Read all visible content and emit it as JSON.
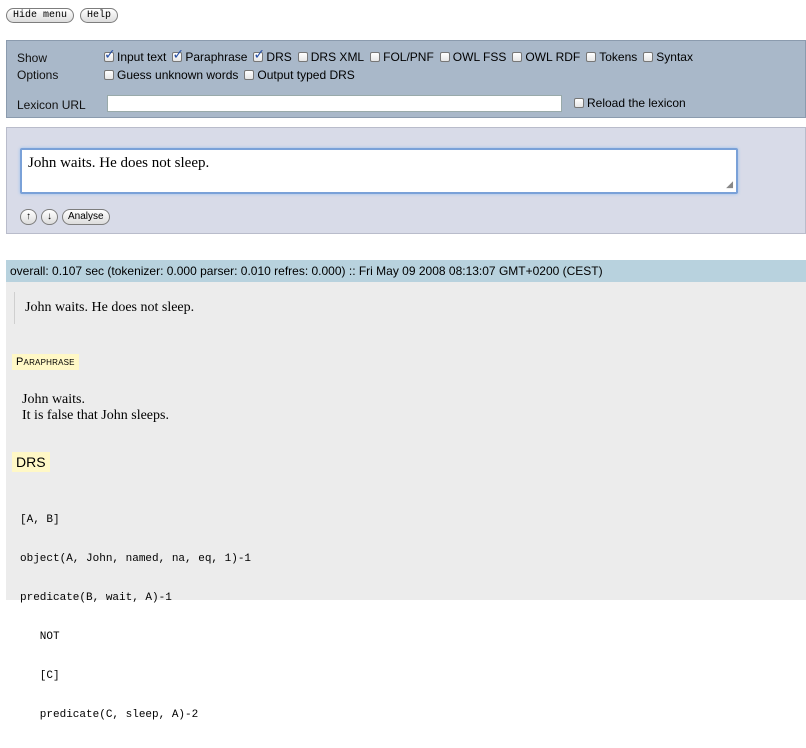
{
  "top_buttons": {
    "hide_menu": "Hide menu",
    "help": "Help"
  },
  "options": {
    "show_label": "Show",
    "options_label": "Options",
    "lexicon_label": "Lexicon URL",
    "show_items": [
      {
        "label": "Input text",
        "checked": true
      },
      {
        "label": "Paraphrase",
        "checked": true
      },
      {
        "label": "DRS",
        "checked": true
      },
      {
        "label": "DRS XML",
        "checked": false
      },
      {
        "label": "FOL/PNF",
        "checked": false
      },
      {
        "label": "OWL FSS",
        "checked": false
      },
      {
        "label": "OWL RDF",
        "checked": false
      },
      {
        "label": "Tokens",
        "checked": false
      },
      {
        "label": "Syntax",
        "checked": false
      }
    ],
    "option_items": [
      {
        "label": "Guess unknown words",
        "checked": false
      },
      {
        "label": "Output typed DRS",
        "checked": false
      }
    ],
    "lexicon_url_value": "",
    "reload_label": "Reload the lexicon"
  },
  "input": {
    "text": "John waits. He does not sleep.",
    "up_label": "↑",
    "down_label": "↓",
    "analyse_label": "Analyse"
  },
  "timing": "overall: 0.107 sec (tokenizer: 0.000 parser: 0.010 refres: 0.000) :: Fri May 09 2008 08:13:07 GMT+0200 (CEST)",
  "results": {
    "echo": "John waits. He does not sleep.",
    "paraphrase_title": "Paraphrase",
    "paraphrase_lines": [
      "John waits.",
      "It is false that John sleeps."
    ],
    "drs_title": "DRS",
    "drs_lines": [
      "[A, B]",
      "object(A, John, named, na, eq, 1)-1",
      "predicate(B, wait, A)-1",
      "   NOT",
      "   [C]",
      "   predicate(C, sleep, A)-2"
    ]
  }
}
